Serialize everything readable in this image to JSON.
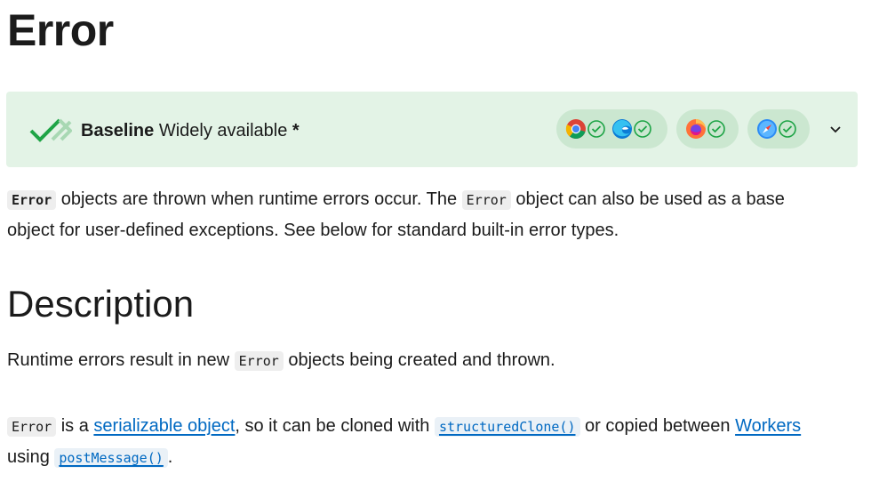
{
  "page": {
    "title": "Error"
  },
  "baseline": {
    "label_bold": "Baseline",
    "label_status": "Widely available",
    "asterisk": "*",
    "icon": "baseline-check-icon",
    "browsers": [
      "chrome-icon",
      "edge-icon",
      "firefox-icon",
      "safari-icon"
    ],
    "expand_icon": "chevron-down-icon",
    "colors": {
      "background": "#e3f3e6",
      "pill": "#cbe7d0",
      "check": "#1ea446"
    }
  },
  "intro": {
    "line1": {
      "code1": "Error",
      "text1": " objects are thrown when runtime errors occur. The ",
      "code2": "Error",
      "text2": " object can also be used as a base"
    },
    "line2": "object for user-defined exceptions. See below for standard built-in error types."
  },
  "description": {
    "heading": "Description",
    "para1": {
      "text1": "Runtime errors result in new ",
      "code": "Error",
      "text2": " objects being created and thrown."
    },
    "para2": {
      "code1": "Error",
      "text1": " is a ",
      "link1": "serializable object",
      "text2": ", so it can be cloned with ",
      "link2": "structuredClone()",
      "text3": " or copied between ",
      "link3": "Workers",
      "text4": "using ",
      "link4": "postMessage()",
      "text5": "."
    }
  },
  "colors": {
    "link": "#0069c2",
    "text": "#1b1b1b",
    "code_bg": "#eeeeee"
  }
}
